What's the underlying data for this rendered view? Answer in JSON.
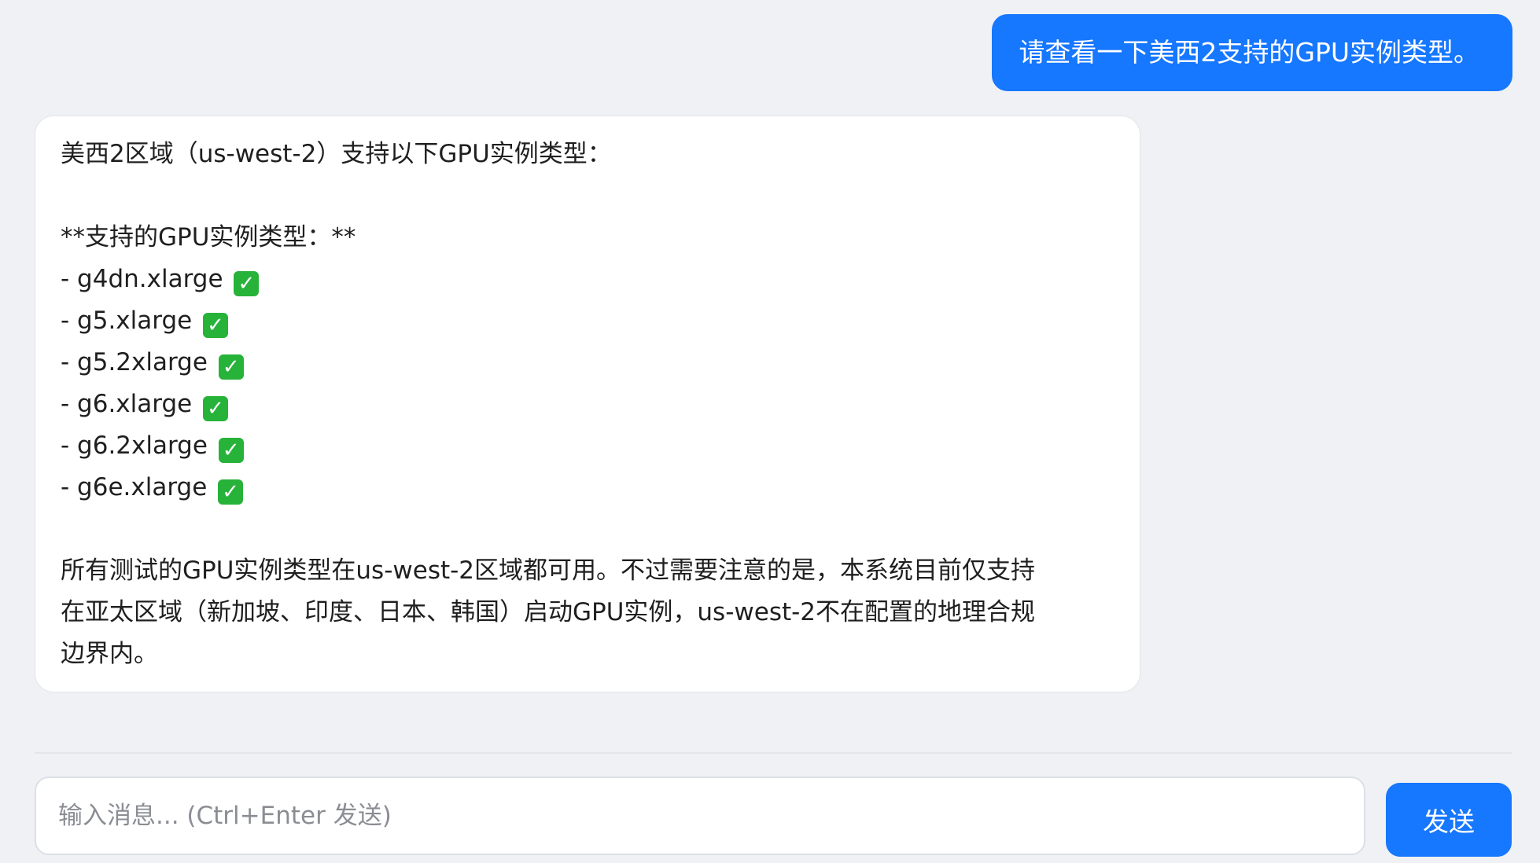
{
  "conversation": {
    "user_message": "请查看一下美西2支持的GPU实例类型。",
    "assistant_message": {
      "intro": "美西2区域（us-west-2）支持以下GPU实例类型：",
      "list_heading": "**支持的GPU实例类型：**",
      "instances": [
        "- g4dn.xlarge",
        "- g5.xlarge",
        "- g5.2xlarge",
        "- g6.xlarge",
        "- g6.2xlarge",
        "- g6e.xlarge"
      ],
      "check_icon": "white-check-mark-emoji",
      "check_color": "#27b23a",
      "conclusion_lines": [
        "所有测试的GPU实例类型在us-west-2区域都可用。不过需要注意的是，本系统目前仅支持",
        "在亚太区域（新加坡、印度、日本、韩国）启动GPU实例，us-west-2不在配置的地理合规",
        "边界内。"
      ]
    }
  },
  "composer": {
    "placeholder": "输入消息... (Ctrl+Enter 发送)",
    "value": "",
    "send_label": "发送"
  },
  "colors": {
    "accent": "#1677ff",
    "background": "#f0f1f5"
  }
}
